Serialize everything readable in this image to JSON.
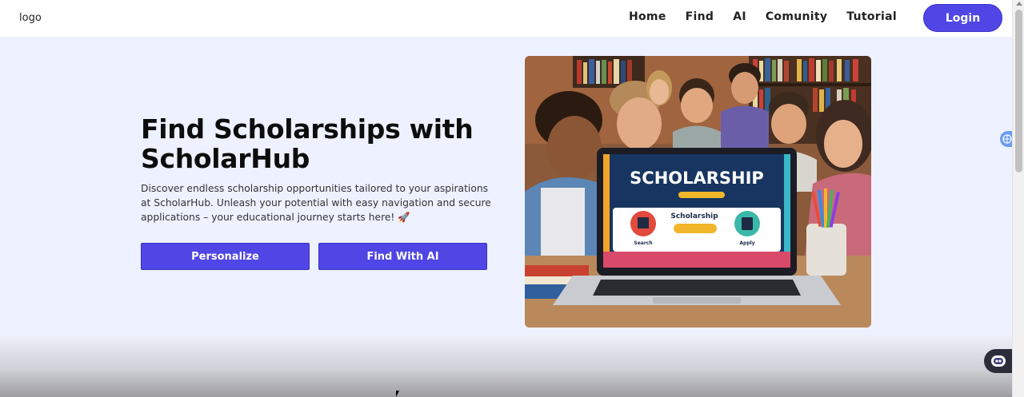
{
  "navbar": {
    "logo": "logo",
    "links": [
      "Home",
      "Find",
      "AI",
      "Comunity",
      "Tutorial"
    ],
    "login_label": "Login"
  },
  "hero": {
    "title": "Find Scholarships with ScholarHub",
    "description": "Discover endless scholarship opportunities tailored to your aspirations at ScholarHub. Unleash your potential with easy navigation and secure applications – your educational journey starts here! 🚀",
    "buttons": {
      "personalize": "Personalize",
      "find_with_ai": "Find With AI"
    },
    "image": {
      "screen_title": "SCHOLARSHIP",
      "screen_center_label": "Scholarship",
      "screen_left_label": "Search",
      "screen_right_label": "Apply"
    }
  },
  "colors": {
    "accent": "#4f46e5",
    "page_bg": "#eef1ff",
    "navbar_bg": "#ffffff"
  }
}
